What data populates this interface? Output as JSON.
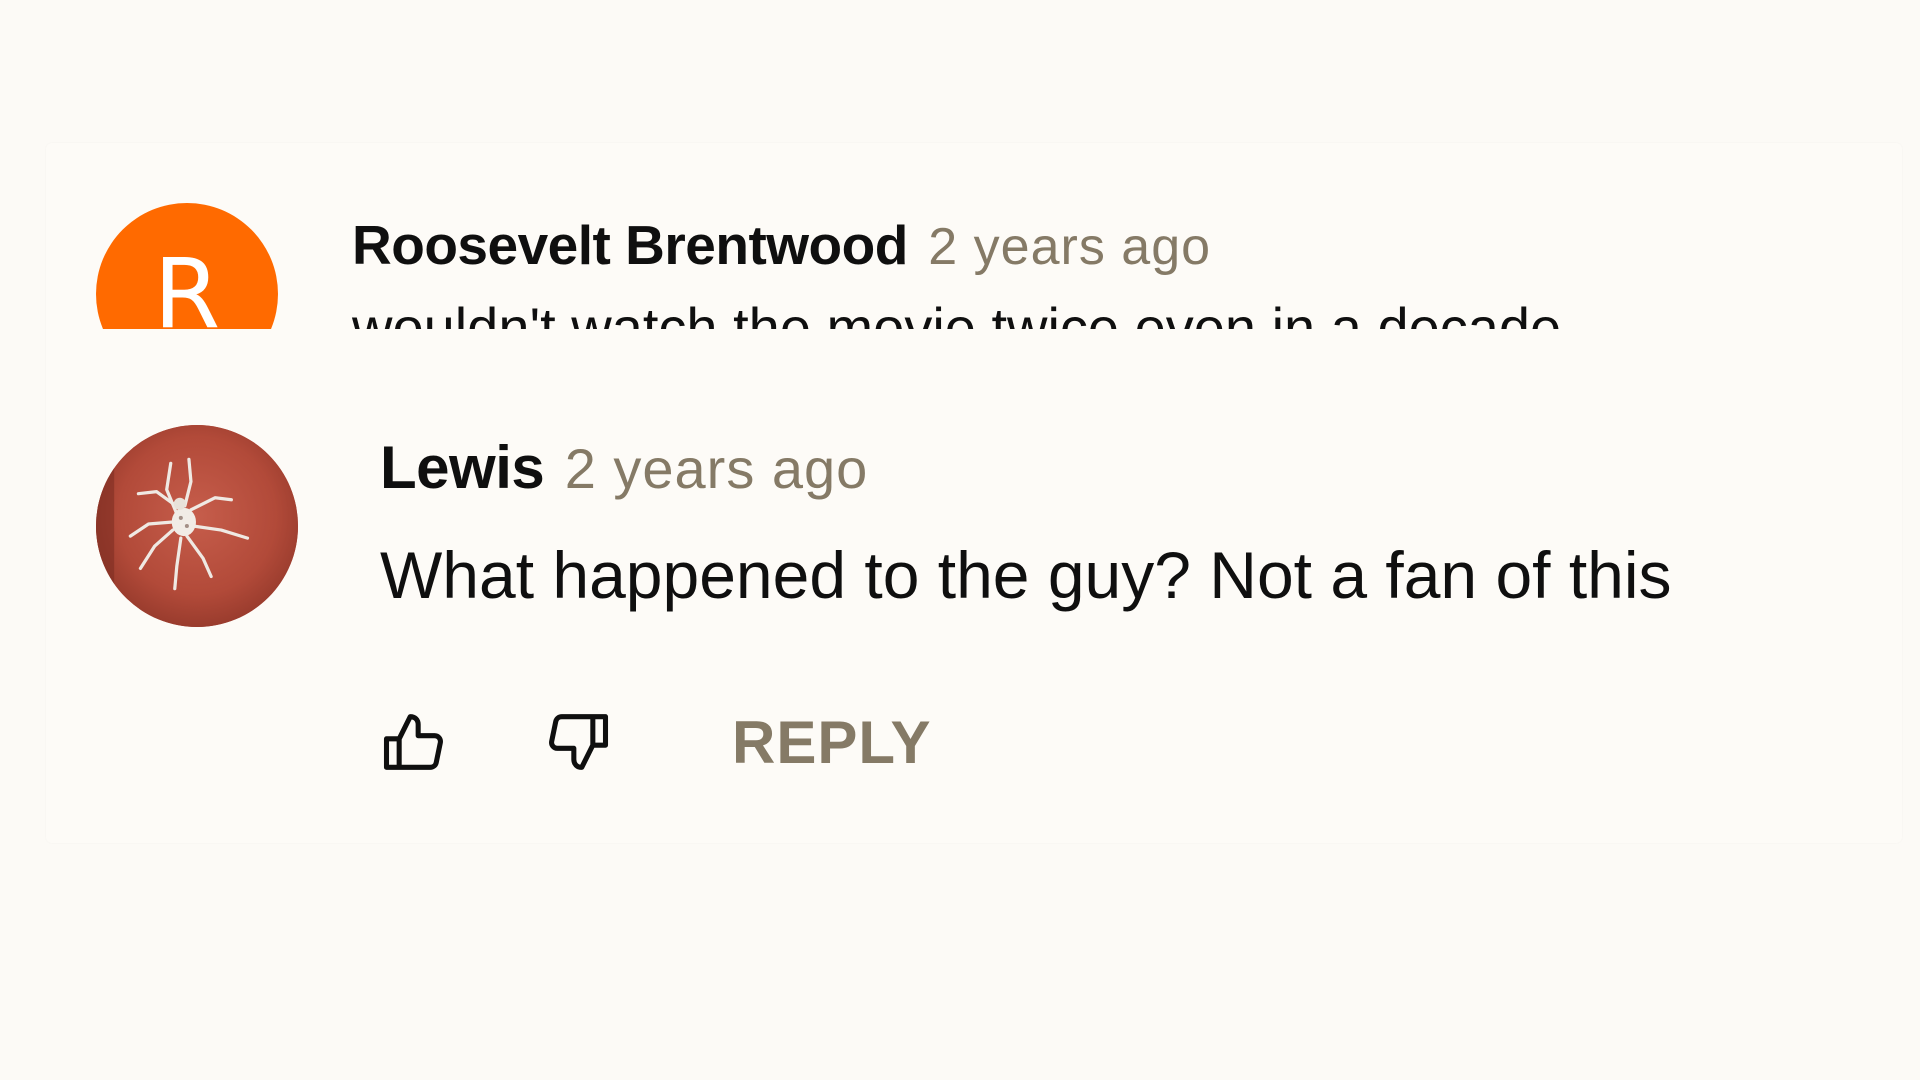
{
  "comments": [
    {
      "author": "Roosevelt Brentwood",
      "time": "2 years ago",
      "avatar": {
        "type": "letter",
        "letter": "R",
        "color": "#ff6a00"
      },
      "text": "wouldn't watch the movie twice even in a decade"
    },
    {
      "author": "Lewis",
      "time": "2 years ago",
      "avatar": {
        "type": "image",
        "icon": "spider-photo",
        "color": "#b34b3a"
      },
      "text": "What happened to the guy? Not a fan of this",
      "actions": {
        "like_icon": "thumbs-up-icon",
        "dislike_icon": "thumbs-down-icon",
        "reply_label": "REPLY"
      }
    }
  ],
  "colors": {
    "background": "#fcfaf6",
    "text": "#0f0f0f",
    "muted": "#857a66"
  }
}
